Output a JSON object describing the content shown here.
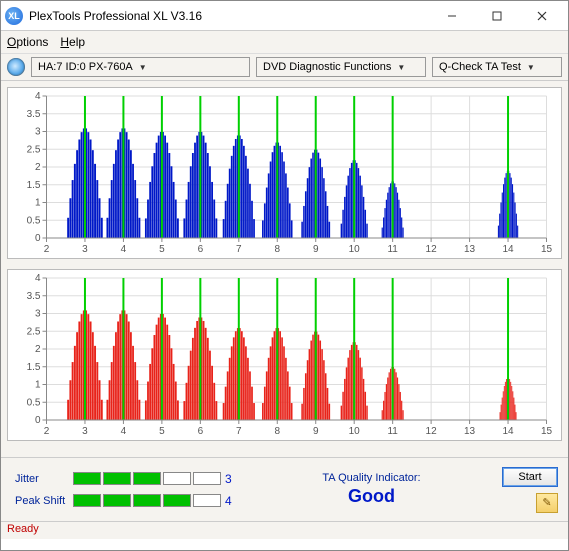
{
  "window": {
    "title": "PlexTools Professional XL V3.16"
  },
  "menu": {
    "options": "Options",
    "help": "Help"
  },
  "toolbar": {
    "drive": "HA:7 ID:0   PX-760A",
    "mode": "DVD Diagnostic Functions",
    "test": "Q-Check TA Test"
  },
  "chart_data": [
    {
      "type": "bar",
      "color": "#0018c8",
      "xlim": [
        2,
        15
      ],
      "ylim": [
        0,
        4
      ],
      "xticks": [
        2,
        3,
        4,
        5,
        6,
        7,
        8,
        9,
        10,
        11,
        12,
        13,
        14,
        15
      ],
      "yticks": [
        0,
        0.5,
        1,
        1.5,
        2,
        2.5,
        3,
        3.5,
        4
      ],
      "peaks": [
        3,
        4,
        5,
        6,
        7,
        8,
        9,
        10,
        11,
        14
      ],
      "series": [
        {
          "center": 3,
          "height": 3.1,
          "width": 1.05
        },
        {
          "center": 4,
          "height": 3.1,
          "width": 1.0
        },
        {
          "center": 5,
          "height": 3.0,
          "width": 1.0
        },
        {
          "center": 6,
          "height": 3.0,
          "width": 1.0
        },
        {
          "center": 7,
          "height": 2.9,
          "width": 0.95
        },
        {
          "center": 8,
          "height": 2.7,
          "width": 0.9
        },
        {
          "center": 9,
          "height": 2.5,
          "width": 0.85
        },
        {
          "center": 10,
          "height": 2.2,
          "width": 0.8
        },
        {
          "center": 11,
          "height": 1.6,
          "width": 0.65
        },
        {
          "center": 14,
          "height": 1.9,
          "width": 0.6
        }
      ]
    },
    {
      "type": "bar",
      "color": "#e8231a",
      "xlim": [
        2,
        15
      ],
      "ylim": [
        0,
        4
      ],
      "xticks": [
        2,
        3,
        4,
        5,
        6,
        7,
        8,
        9,
        10,
        11,
        12,
        13,
        14,
        15
      ],
      "yticks": [
        0,
        0.5,
        1,
        1.5,
        2,
        2.5,
        3,
        3.5,
        4
      ],
      "peaks": [
        3,
        4,
        5,
        6,
        7,
        8,
        9,
        10,
        11,
        14
      ],
      "series": [
        {
          "center": 3,
          "height": 3.1,
          "width": 1.05
        },
        {
          "center": 4,
          "height": 3.1,
          "width": 1.0
        },
        {
          "center": 5,
          "height": 3.0,
          "width": 1.0
        },
        {
          "center": 6,
          "height": 2.9,
          "width": 1.0
        },
        {
          "center": 7,
          "height": 2.6,
          "width": 0.95
        },
        {
          "center": 8,
          "height": 2.6,
          "width": 0.9
        },
        {
          "center": 9,
          "height": 2.5,
          "width": 0.85
        },
        {
          "center": 10,
          "height": 2.2,
          "width": 0.8
        },
        {
          "center": 11,
          "height": 1.5,
          "width": 0.65
        },
        {
          "center": 14,
          "height": 1.2,
          "width": 0.5
        }
      ]
    }
  ],
  "metrics": {
    "jitter": {
      "label": "Jitter",
      "value": 3,
      "max": 5
    },
    "peakshift": {
      "label": "Peak Shift",
      "value": 4,
      "max": 5
    }
  },
  "quality": {
    "label": "TA Quality Indicator:",
    "value": "Good"
  },
  "buttons": {
    "start": "Start"
  },
  "status": "Ready"
}
